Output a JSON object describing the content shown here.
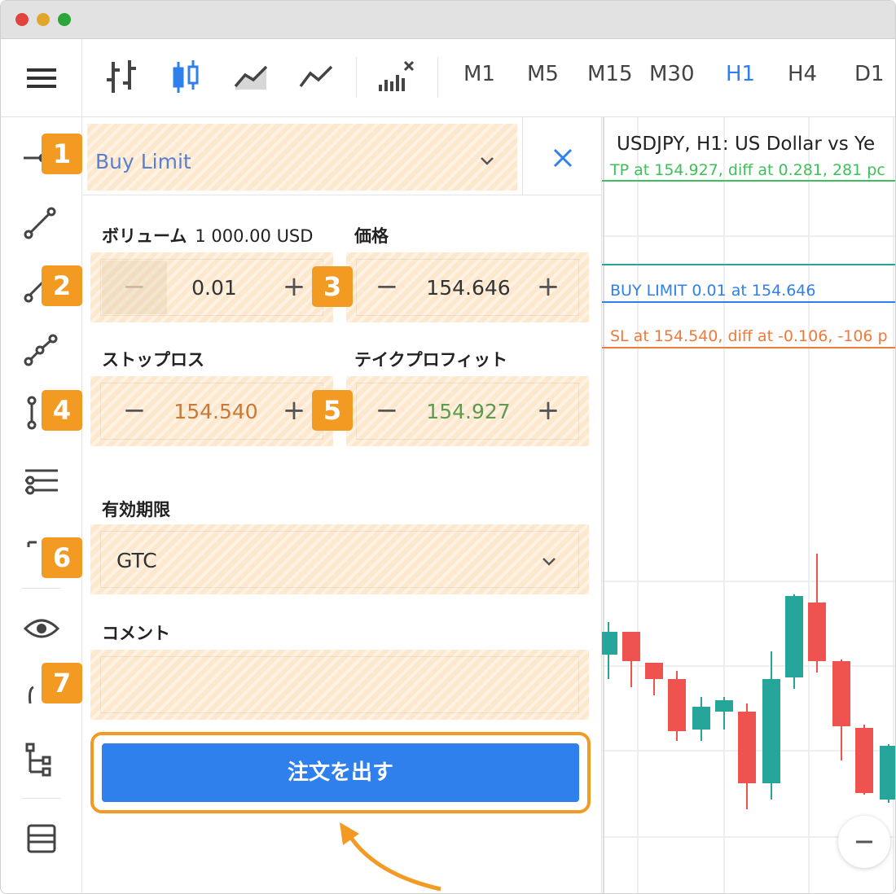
{
  "toolbar": {
    "timeframes": [
      "M1",
      "M5",
      "M15",
      "M30",
      "H1",
      "H4",
      "D1"
    ],
    "active_timeframe": "H1"
  },
  "sidebar": {
    "badges": [
      "1",
      "2",
      "4",
      "6",
      "7"
    ]
  },
  "order": {
    "type": "Buy Limit",
    "volume_label": "ボリューム",
    "volume_sub": "1 000.00 USD",
    "volume_value": "0.01",
    "price_label": "価格",
    "price_value": "154.646",
    "sl_label": "ストップロス",
    "sl_value": "154.540",
    "tp_label": "テイクプロフィット",
    "tp_value": "154.927",
    "expiry_label": "有効期限",
    "expiry_value": "GTC",
    "comment_label": "コメント",
    "comment_value": "",
    "submit_label": "注文を出す",
    "badges": [
      "3",
      "5"
    ]
  },
  "chart": {
    "title": "USDJPY, H1: US Dollar vs Ye",
    "tp_line": "TP at 154.927, diff at 0.281, 281 pc",
    "buy_line": "BUY LIMIT 0.01 at 154.646",
    "sl_line": "SL at 154.540, diff at -0.106, -106 p"
  },
  "colors": {
    "accent_blue": "#2f80ed",
    "badge_orange": "#f39a22",
    "bull": "#26a69a",
    "bear": "#ef5350",
    "tp_green": "#3fbf5a",
    "sl_orange": "#f07a3a",
    "sl_value": "#c8793a",
    "tp_value": "#5e9a52"
  }
}
